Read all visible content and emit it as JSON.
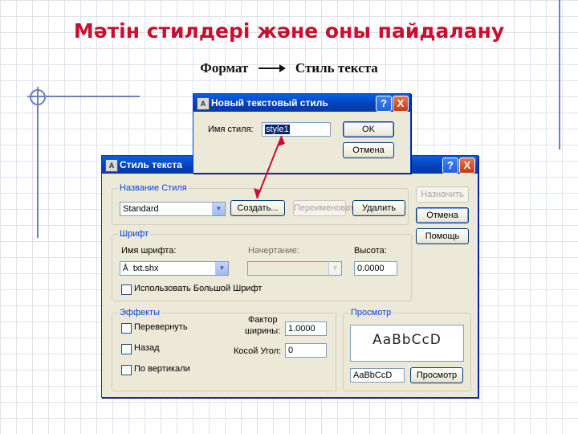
{
  "slide": {
    "title": "Мәтін стилдері және оны пайдалану",
    "menu_path": {
      "menu": "Формат",
      "item": "Стиль текста"
    }
  },
  "new_style_dialog": {
    "title": "Новый текстовый стиль",
    "help_button": "?",
    "close_button": "X",
    "name_label": "Имя стиля:",
    "name_value": "style1",
    "ok_button": "OK",
    "cancel_button": "Отмена"
  },
  "text_style_dialog": {
    "title": "Стиль текста",
    "help_button": "?",
    "close_button": "X",
    "style_name_group": "Название Стиля",
    "style_name_value": "Standard",
    "new_button": "Создать...",
    "rename_button": "Переименовать...",
    "delete_button": "Удалить",
    "apply_button": "Назначить",
    "cancel_button": "Отмена",
    "help_text_button": "Помощь",
    "font_group": "Шрифт",
    "font_name_label": "Имя шрифта:",
    "font_name_value": "txt.shx",
    "font_style_label": "Начертание:",
    "font_style_value": "",
    "height_label": "Высота:",
    "height_value": "0.0000",
    "big_font_label": "Использовать Большой Шрифт",
    "effects_group": "Эффекты",
    "upside_down_label": "Перевернуть",
    "backwards_label": "Назад",
    "vertical_label": "По вертикали",
    "width_factor_label_1": "Фактор",
    "width_factor_label_2": "ширины:",
    "width_factor_value": "1.0000",
    "oblique_label": "Косой Угол:",
    "oblique_value": "0",
    "preview_group": "Просмотр",
    "preview_sample": "AaBbCcD",
    "preview_input_value": "AaBbCcD",
    "preview_button": "Просмотр"
  },
  "colors": {
    "title_red": "#c8102e",
    "xp_blue": "#0a5ee5",
    "dialog_bg": "#ece9d8"
  }
}
